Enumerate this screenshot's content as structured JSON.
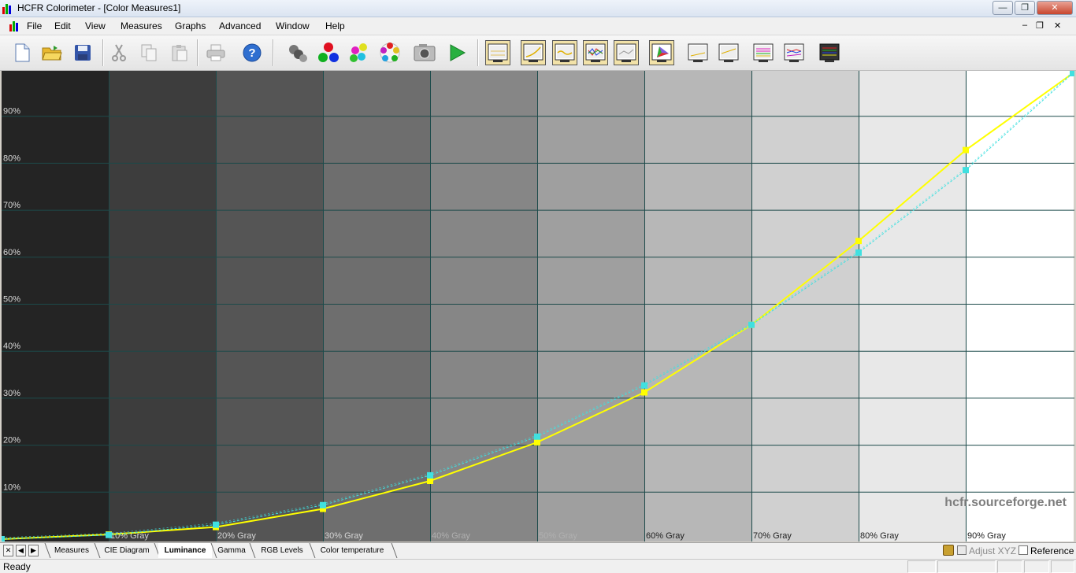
{
  "window": {
    "title": "HCFR Colorimeter - [Color Measures1]",
    "minimize_glyph": "—",
    "maximize_glyph": "❐",
    "close_glyph": "✕"
  },
  "menu": {
    "items": [
      "File",
      "Edit",
      "View",
      "Measures",
      "Graphs",
      "Advanced",
      "Window",
      "Help"
    ],
    "mdi_minimize": "–",
    "mdi_restore": "❐",
    "mdi_close": "✕"
  },
  "toolbar": {
    "buttons": [
      "new-document-icon",
      "open-folder-icon",
      "save-icon",
      "cut-icon",
      "copy-icon",
      "paste-icon",
      "print-icon",
      "help-icon",
      "sensor-icon",
      "primary-colors-icon",
      "secondary-colors-icon",
      "saturation-icon",
      "camera-icon",
      "play-icon",
      "grayscale-chart-icon",
      "luminance-chart-icon",
      "gamma-chart-icon",
      "rgb-levels-chart-icon",
      "color-temperature-chart-icon",
      "cie-diagram-icon",
      "near-black-chart-icon",
      "near-white-chart-icon",
      "saturation-chart-icon",
      "saturation-shift-chart-icon",
      "measures-chart-icon"
    ]
  },
  "graph": {
    "watermark": "hcfr.sourceforge.net",
    "colors": {
      "measured": "#ffff00",
      "reference": "#40e0e0",
      "grid": "#1c4a4a"
    }
  },
  "chart_data": {
    "type": "line",
    "title": "",
    "xlabel": "",
    "ylabel": "",
    "ylim": [
      0,
      100
    ],
    "x_tick_labels": [
      "10% Gray",
      "20% Gray",
      "30% Gray",
      "40% Gray",
      "50% Gray",
      "60% Gray",
      "70% Gray",
      "80% Gray",
      "90% Gray"
    ],
    "y_tick_labels": [
      "10%",
      "20%",
      "30%",
      "40%",
      "50%",
      "60%",
      "70%",
      "80%",
      "90%"
    ],
    "grid": true,
    "x": [
      0,
      10,
      20,
      30,
      40,
      50,
      60,
      70,
      80,
      90,
      100
    ],
    "series": [
      {
        "values": [
          0,
          1,
          2.6,
          6.5,
          12.5,
          20.8,
          31.5,
          46,
          64,
          83.5,
          100
        ]
      },
      {
        "values": [
          0,
          0.9,
          3.1,
          7.3,
          13.7,
          22,
          33,
          46,
          61.5,
          79.2,
          100
        ]
      }
    ]
  },
  "tabs": {
    "nav": [
      "✕",
      "◀",
      "▶"
    ],
    "items": [
      "Measures",
      "CIE Diagram",
      "Luminance",
      "Gamma",
      "RGB Levels",
      "Color temperature"
    ],
    "active": "Luminance",
    "adjust_xyz": "Adjust XYZ",
    "reference": "Reference"
  },
  "status": {
    "text": "Ready"
  }
}
